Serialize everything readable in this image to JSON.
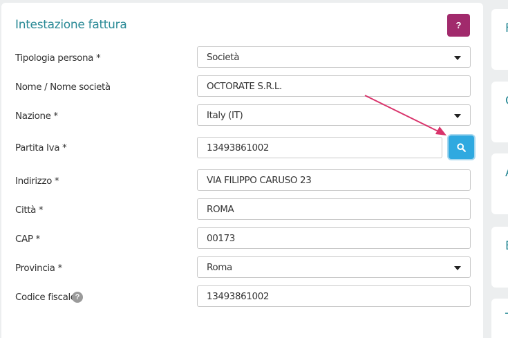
{
  "card": {
    "title": "Intestazione fattura",
    "help_label": "?"
  },
  "fields": {
    "tipologia": {
      "label": "Tipologia persona *",
      "value": "Società"
    },
    "nome": {
      "label": "Nome / Nome società",
      "value": "OCTORATE S.R.L."
    },
    "nazione": {
      "label": "Nazione *",
      "value": "Italy (IT)"
    },
    "partita_iva": {
      "label": "Partita Iva  *",
      "value": "13493861002"
    },
    "indirizzo": {
      "label": "Indirizzo *",
      "value": "VIA FILIPPO CARUSO 23"
    },
    "citta": {
      "label": "Città *",
      "value": "ROMA"
    },
    "cap": {
      "label": "CAP *",
      "value": "00173"
    },
    "provincia": {
      "label": "Provincia *",
      "value": "Roma"
    },
    "codice_fiscale": {
      "label": "Codice fiscale",
      "value": "13493861002",
      "info_label": "?"
    }
  },
  "side_cards": [
    "F",
    "C",
    "A",
    "E",
    "T"
  ],
  "colors": {
    "title": "#2a8a96",
    "help_button": "#a12a6c",
    "search_button": "#2fa9e0",
    "annotation_arrow": "#d9336b"
  },
  "icons": {
    "search": "search-icon",
    "caret": "chevron-down-icon",
    "help": "question-icon"
  }
}
